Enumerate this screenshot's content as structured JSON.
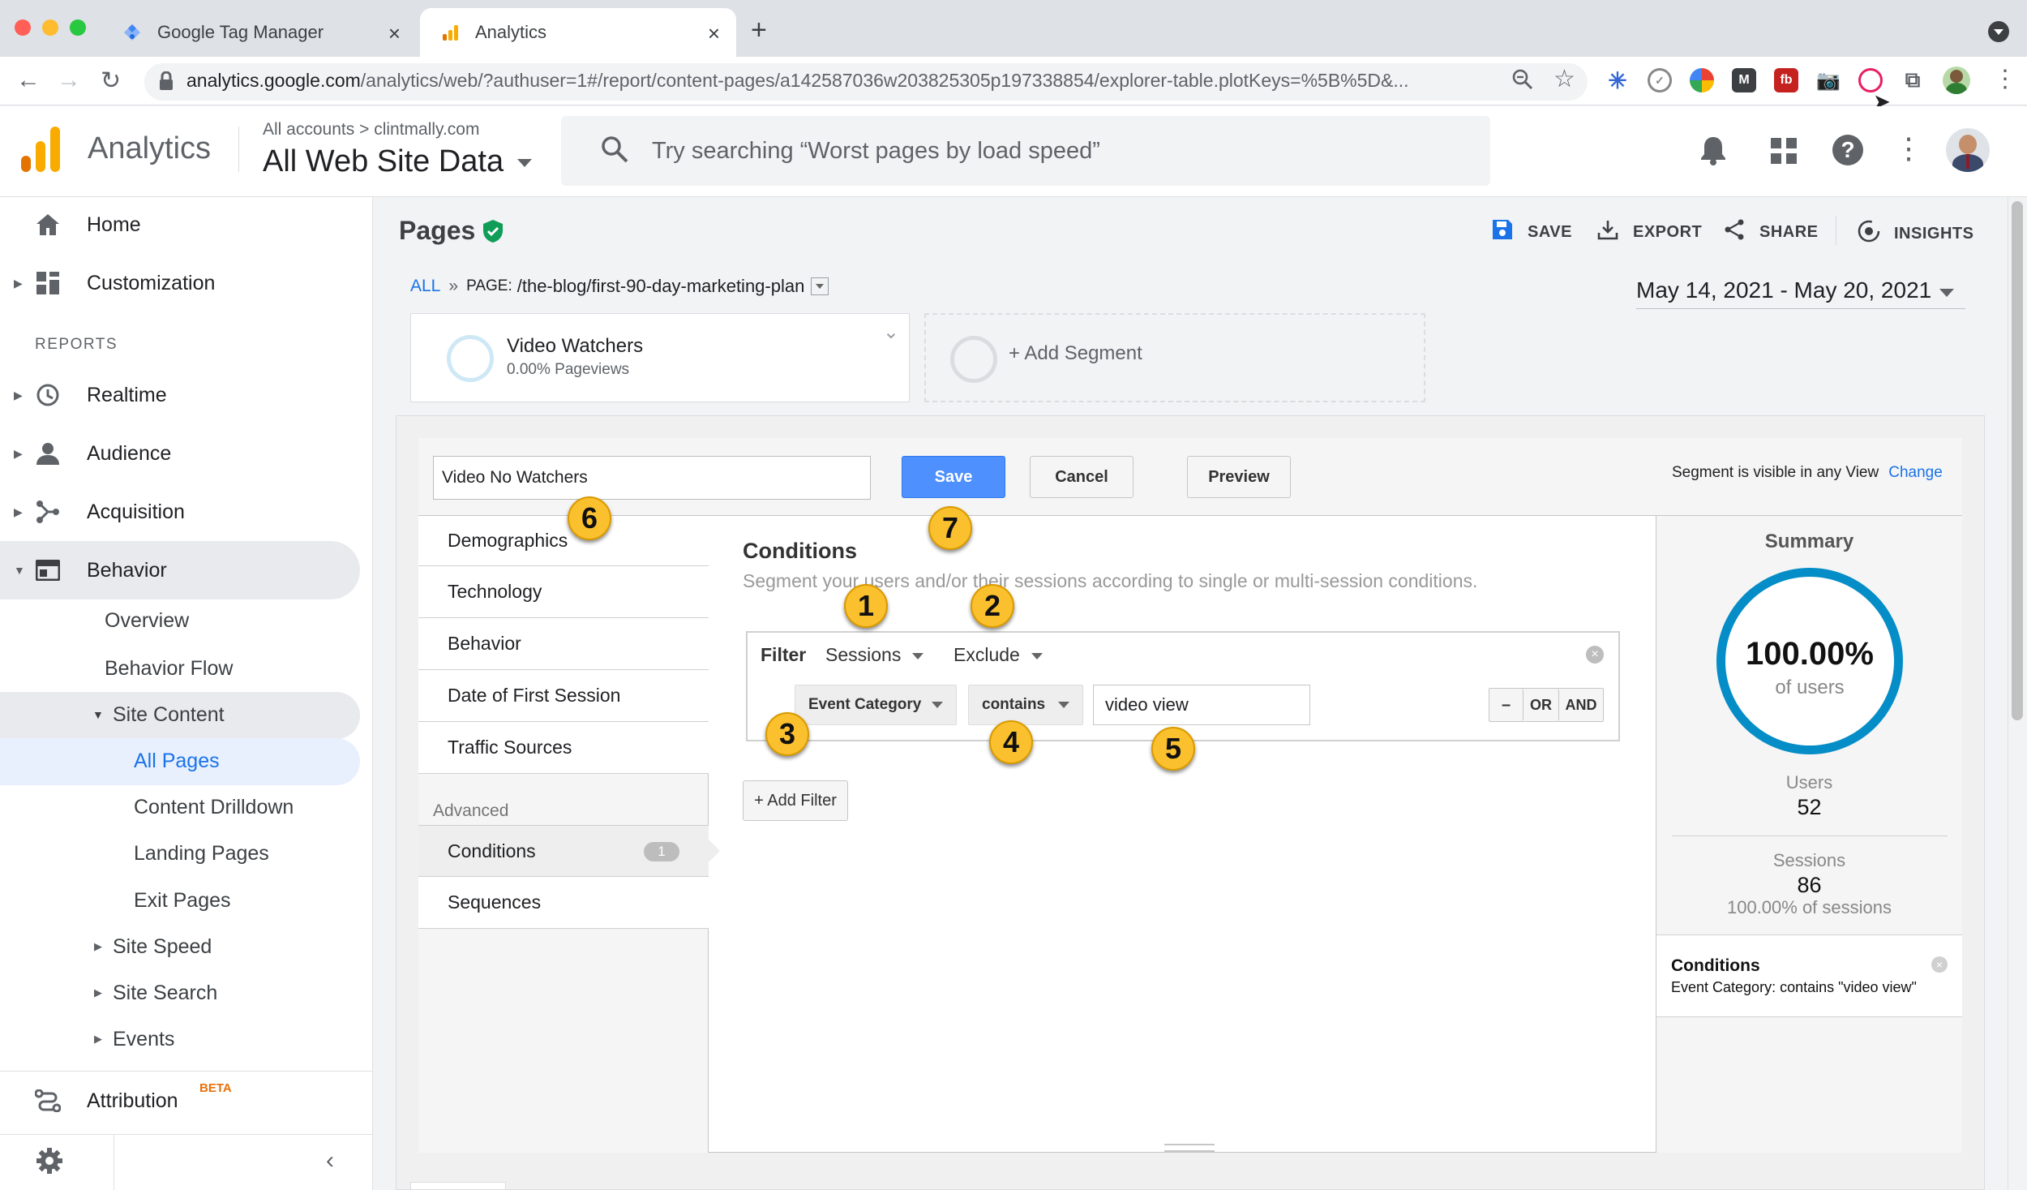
{
  "browser": {
    "tabs": [
      {
        "title": "Google Tag Manager"
      },
      {
        "title": "Analytics"
      }
    ],
    "url_domain": "analytics.google.com",
    "url_path": "/analytics/web/?authuser=1#/report/content-pages/a142587036w203825305p197338854/explorer-table.plotKeys=%5B%5D&..."
  },
  "header": {
    "app_name": "Analytics",
    "breadcrumb_accounts": "All accounts",
    "breadcrumb_property": "clintmally.com",
    "view_name": "All Web Site Data",
    "search_placeholder": "Try searching “Worst pages by load speed”"
  },
  "sidebar": {
    "home": "Home",
    "customization": "Customization",
    "reports_heading": "REPORTS",
    "realtime": "Realtime",
    "audience": "Audience",
    "acquisition": "Acquisition",
    "behavior": "Behavior",
    "overview": "Overview",
    "behavior_flow": "Behavior Flow",
    "site_content": "Site Content",
    "all_pages": "All Pages",
    "content_drilldown": "Content Drilldown",
    "landing_pages": "Landing Pages",
    "exit_pages": "Exit Pages",
    "site_speed": "Site Speed",
    "site_search": "Site Search",
    "events": "Events",
    "attribution": "Attribution",
    "attribution_badge": "BETA"
  },
  "report": {
    "title": "Pages",
    "actions": {
      "save": "SAVE",
      "export": "EXPORT",
      "share": "SHARE",
      "insights": "INSIGHTS"
    },
    "crumb_all": "ALL",
    "crumb_sep": "»",
    "crumb_page_label": "PAGE:",
    "crumb_page_value": "/the-blog/first-90-day-marketing-plan",
    "date_range": "May 14, 2021 - May 20, 2021",
    "segment_name": "Video Watchers",
    "segment_metric": "0.00% Pageviews",
    "add_segment": "+ Add Segment"
  },
  "segment_editor": {
    "name_value": "Video No Watchers",
    "save": "Save",
    "cancel": "Cancel",
    "preview": "Preview",
    "visibility_text": "Segment is visible in any View",
    "change_link": "Change",
    "categories": [
      "Demographics",
      "Technology",
      "Behavior",
      "Date of First Session",
      "Traffic Sources"
    ],
    "advanced_label": "Advanced",
    "conditions_label": "Conditions",
    "conditions_count": "1",
    "sequences_label": "Sequences",
    "conditions_title": "Conditions",
    "conditions_desc": "Segment your users and/or their sessions according to single or multi-session conditions.",
    "filter_label": "Filter",
    "filter_scope": "Sessions",
    "filter_mode": "Exclude",
    "dimension": "Event Category",
    "operator": "contains",
    "value": "video view",
    "minus": "–",
    "or": "OR",
    "and": "AND",
    "add_filter": "+ Add Filter"
  },
  "summary": {
    "title": "Summary",
    "percent": "100.00%",
    "percent_label": "of users",
    "users_label": "Users",
    "users_value": "52",
    "sessions_label": "Sessions",
    "sessions_value": "86",
    "sessions_pct": "100.00% of sessions",
    "conditions_title": "Conditions",
    "conditions_text": "Event Category: contains \"video view\""
  },
  "annotations": [
    "1",
    "2",
    "3",
    "4",
    "5",
    "6",
    "7"
  ],
  "colors": {
    "accent": "#4285f4",
    "ga_orange": "#f9ab00",
    "summary_ring": "#058dc7",
    "badge": "#fbc02d"
  }
}
